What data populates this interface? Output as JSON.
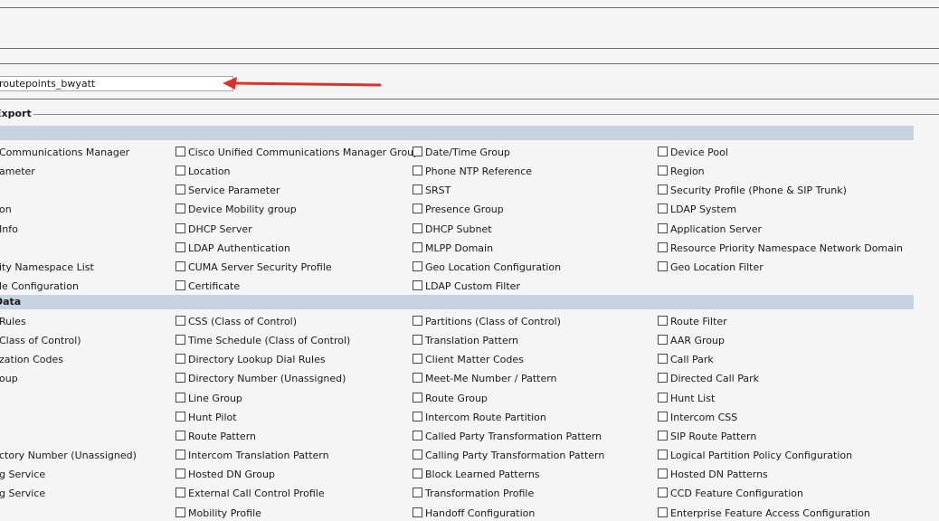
{
  "file_input": {
    "value": "routepoints_bwyatt"
  },
  "legend": {
    "label": "Export"
  },
  "sections": [
    {
      "label": ""
    },
    {
      "label": "Data"
    }
  ],
  "left_truncated": [
    "Communications Manager",
    "ameter",
    "",
    "on",
    "Info",
    "",
    "ity Namespace List",
    "le Configuration",
    "Rules",
    "Class of Control)",
    "zation Codes",
    "oup",
    "",
    "",
    "",
    "ctory Number (Unassigned)",
    "g Service",
    "g Service",
    ""
  ],
  "section1_rows": [
    [
      "Cisco Unified Communications Manager Group",
      "Date/Time Group",
      "Device Pool"
    ],
    [
      "Location",
      "Phone NTP Reference",
      "Region"
    ],
    [
      "Service Parameter",
      "SRST",
      "Security Profile (Phone & SIP Trunk)"
    ],
    [
      "Device Mobility group",
      "Presence Group",
      "LDAP System"
    ],
    [
      "DHCP Server",
      "DHCP Subnet",
      "Application Server"
    ],
    [
      "LDAP Authentication",
      "MLPP Domain",
      "Resource Priority Namespace Network Domain"
    ],
    [
      "CUMA Server Security Profile",
      "Geo Location Configuration",
      "Geo Location Filter"
    ],
    [
      "Certificate",
      "LDAP Custom Filter",
      ""
    ]
  ],
  "section2_rows": [
    [
      "CSS (Class of Control)",
      "Partitions (Class of Control)",
      "Route Filter"
    ],
    [
      "Time Schedule (Class of Control)",
      "Translation Pattern",
      "AAR Group"
    ],
    [
      "Directory Lookup Dial Rules",
      "Client Matter Codes",
      "Call Park"
    ],
    [
      "Directory Number (Unassigned)",
      "Meet-Me Number / Pattern",
      "Directed Call Park"
    ],
    [
      "Line Group",
      "Route Group",
      "Hunt List"
    ],
    [
      "Hunt Pilot",
      "Intercom Route Partition",
      "Intercom CSS"
    ],
    [
      "Route Pattern",
      "Called Party Transformation Pattern",
      "SIP Route Pattern"
    ],
    [
      "Intercom Translation Pattern",
      "Calling Party Transformation Pattern",
      "Logical Partition Policy Configuration"
    ],
    [
      "Hosted DN Group",
      "Block Learned Patterns",
      "Hosted DN Patterns"
    ],
    [
      "External Call Control Profile",
      "Transformation Profile",
      "CCD Feature Configuration"
    ],
    [
      "Mobility Profile",
      "Handoff Configuration",
      "Enterprise Feature Access Configuration"
    ]
  ],
  "colors": {
    "section_bar": "#c8d3e2",
    "arrow": "#d9332e"
  }
}
